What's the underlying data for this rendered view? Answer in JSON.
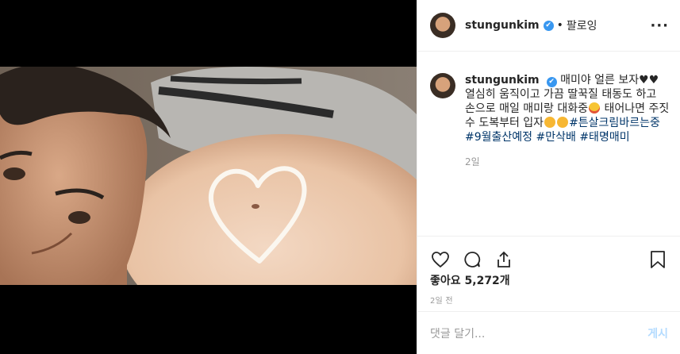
{
  "header": {
    "username": "stungunkim",
    "verified_mark": "✔",
    "separator": "•",
    "follow_label": "팔로잉",
    "more_label": "···"
  },
  "caption": {
    "username": "stungunkim",
    "verified_mark": "✔",
    "text_part1": "매미야 얼른 보자",
    "hearts": "♥♥",
    "text_part2": " 열심히 움직이고 가끔 딸꾹질 태동도 하고 손으로 매일 매미랑 대화중",
    "text_part3": " 태어나면 주짓수 도복부터 입자",
    "hashtags": [
      "#튼살크림바르는중",
      "#9월출산예정",
      "#만삭배",
      "#태명매미"
    ],
    "age": "2일"
  },
  "icons": {
    "like": "heart-icon",
    "comment": "comment-icon",
    "share": "share-icon",
    "save": "bookmark-icon"
  },
  "likes": {
    "label": "좋아요",
    "count": "5,272개"
  },
  "timestamp": "2일 전",
  "comment_box": {
    "placeholder": "댓글 달기...",
    "post_label": "게시"
  },
  "colors": {
    "link": "#003569",
    "verified": "#3897f0",
    "post_button": "#b3dbff"
  }
}
